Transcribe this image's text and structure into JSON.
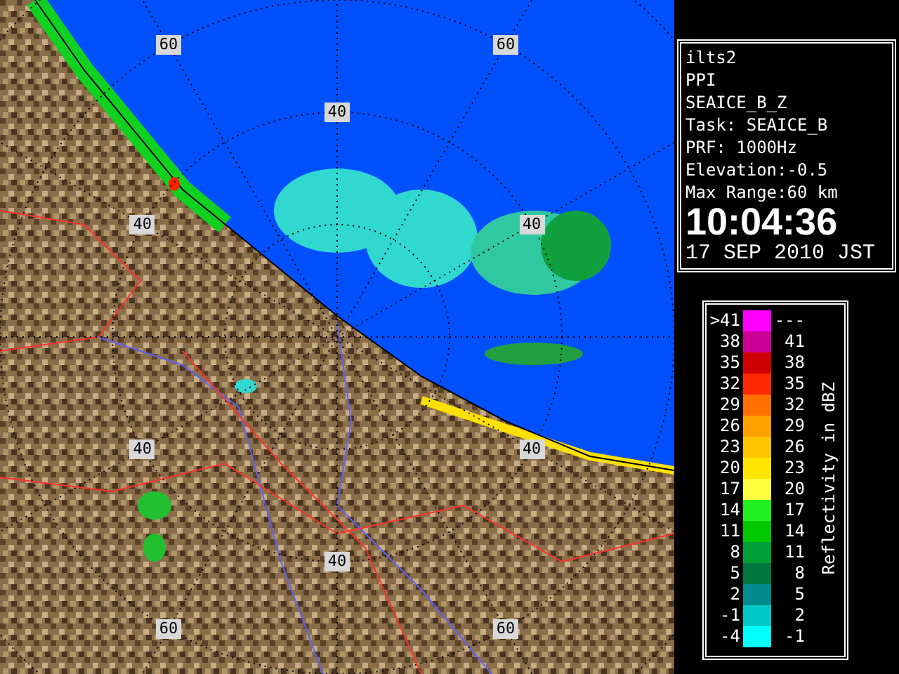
{
  "radar_map": {
    "range_labels": [
      {
        "text": "60"
      },
      {
        "text": "60"
      },
      {
        "text": "40"
      },
      {
        "text": "40"
      },
      {
        "text": "40"
      },
      {
        "text": "40"
      },
      {
        "text": "40"
      },
      {
        "text": "40"
      },
      {
        "text": "60"
      },
      {
        "text": "60"
      }
    ]
  },
  "info_panel": {
    "lines": [
      "ilts2",
      "PPI",
      "SEAICE_B_Z",
      "Task: SEAICE_B",
      "PRF: 1000Hz",
      "Elevation:-0.5",
      "Max Range:60 km"
    ],
    "time": "10:04:36",
    "date": "17 SEP 2010 JST"
  },
  "legend": {
    "title": "Reflectivity in dBZ",
    "rows": [
      {
        "low": ">41",
        "high": "---",
        "color": "#ff00ff"
      },
      {
        "low": "38",
        "high": "41",
        "color": "#cc0099"
      },
      {
        "low": "35",
        "high": "38",
        "color": "#d00000"
      },
      {
        "low": "32",
        "high": "35",
        "color": "#ff2800"
      },
      {
        "low": "29",
        "high": "32",
        "color": "#ff7000"
      },
      {
        "low": "26",
        "high": "29",
        "color": "#ffa000"
      },
      {
        "low": "23",
        "high": "26",
        "color": "#ffc400"
      },
      {
        "low": "20",
        "high": "23",
        "color": "#ffe600"
      },
      {
        "low": "17",
        "high": "20",
        "color": "#ffff40"
      },
      {
        "low": "14",
        "high": "17",
        "color": "#20f020"
      },
      {
        "low": "11",
        "high": "14",
        "color": "#00c800"
      },
      {
        "low": "8",
        "high": "11",
        "color": "#00a038"
      },
      {
        "low": "5",
        "high": "8",
        "color": "#007840"
      },
      {
        "low": "2",
        "high": "5",
        "color": "#008c8c"
      },
      {
        "low": "-1",
        "high": "2",
        "color": "#00c8c8"
      },
      {
        "low": "-4",
        "high": "-1",
        "color": "#00ffff"
      }
    ]
  }
}
